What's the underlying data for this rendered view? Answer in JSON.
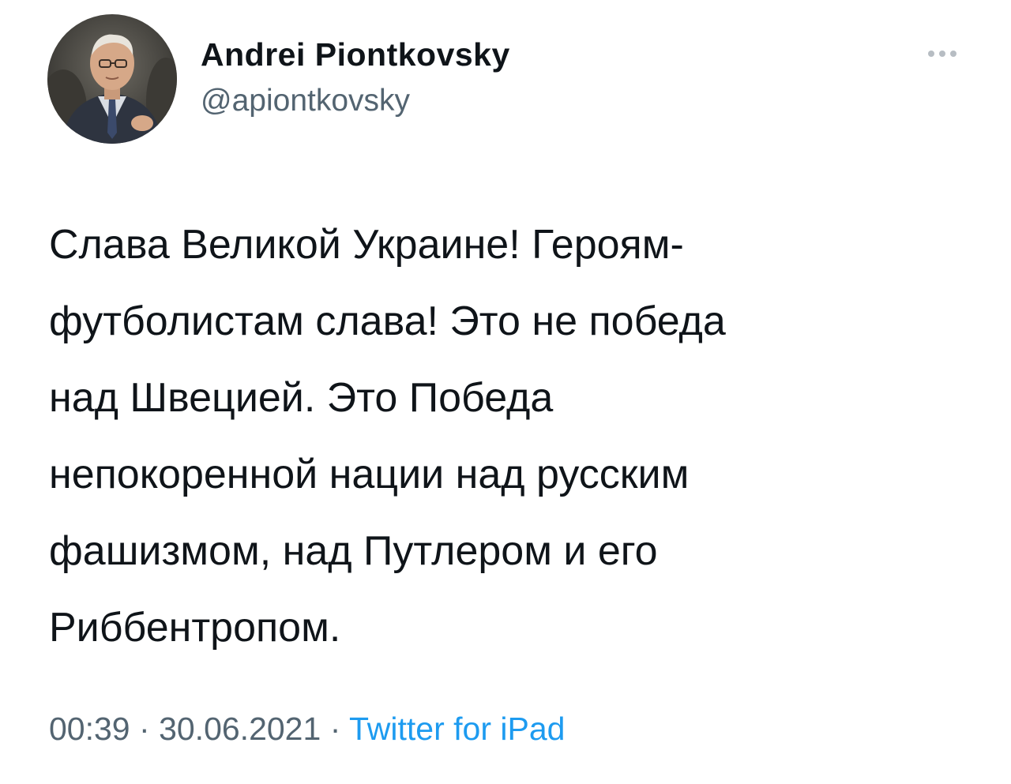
{
  "author": {
    "display_name": "Andrei Piontkovsky",
    "handle": "@apiontkovsky",
    "avatar_icon": "user-avatar-photo"
  },
  "more_icon": "more-horizontal-icon",
  "tweet": {
    "lines": [
      "Слава Великой Украине! Героям-",
      "футболистам слава! Это не победа",
      "над Швецией. Это Победа",
      "непокоренной нации над русским",
      "фашизмом, над Путлером и его",
      "Риббентропом."
    ],
    "time": "00:39",
    "date": "30.06.2021",
    "separator": "·",
    "source": "Twitter for iPad"
  },
  "colors": {
    "text": "#0f1419",
    "secondary": "#536471",
    "link": "#1d9bf0"
  }
}
